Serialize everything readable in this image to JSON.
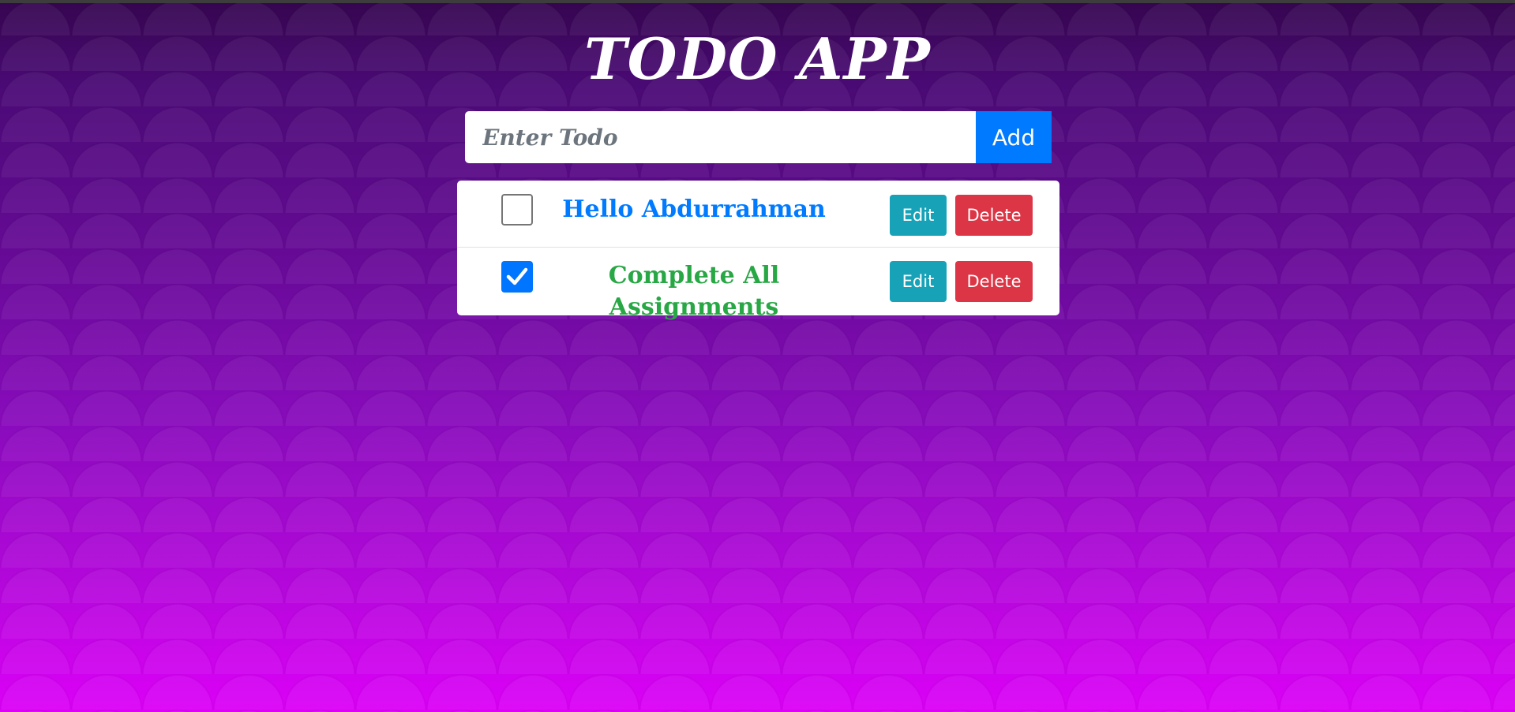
{
  "app": {
    "title": "TODO APP"
  },
  "input": {
    "placeholder": "Enter Todo",
    "value": ""
  },
  "add_button": {
    "label": "Add"
  },
  "todos": [
    {
      "text": "Hello Abdurrahman",
      "completed": false,
      "text_color": "#007bff",
      "edit_label": "Edit",
      "delete_label": "Delete"
    },
    {
      "text": "Complete All Assignments",
      "completed": true,
      "text_color": "#28a745",
      "edit_label": "Edit",
      "delete_label": "Delete"
    }
  ],
  "colors": {
    "background_top": "#35054f",
    "background_bottom": "#dc00f7",
    "add_button": "#007bff",
    "edit_button": "#17a2b8",
    "delete_button": "#dc3545",
    "checkbox_checked": "#0075ff"
  },
  "icons": {
    "checkmark": "check-icon"
  }
}
